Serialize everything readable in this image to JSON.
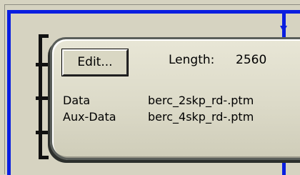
{
  "node": {
    "edit_button_label": "Edit...",
    "length_label": "Length:",
    "length_value": "2560",
    "rows": [
      {
        "label": "Data",
        "value": "berc_2skp_rd-.ptm"
      },
      {
        "label": "Aux-Data",
        "value": "berc_4skp_rd-.ptm"
      }
    ]
  },
  "colors": {
    "wire": "#0a1ee0",
    "background": "#d6d3c1",
    "panel": "#dcdac8",
    "bracket": "#111111"
  },
  "icons": [
    "down-arrow-icon"
  ]
}
